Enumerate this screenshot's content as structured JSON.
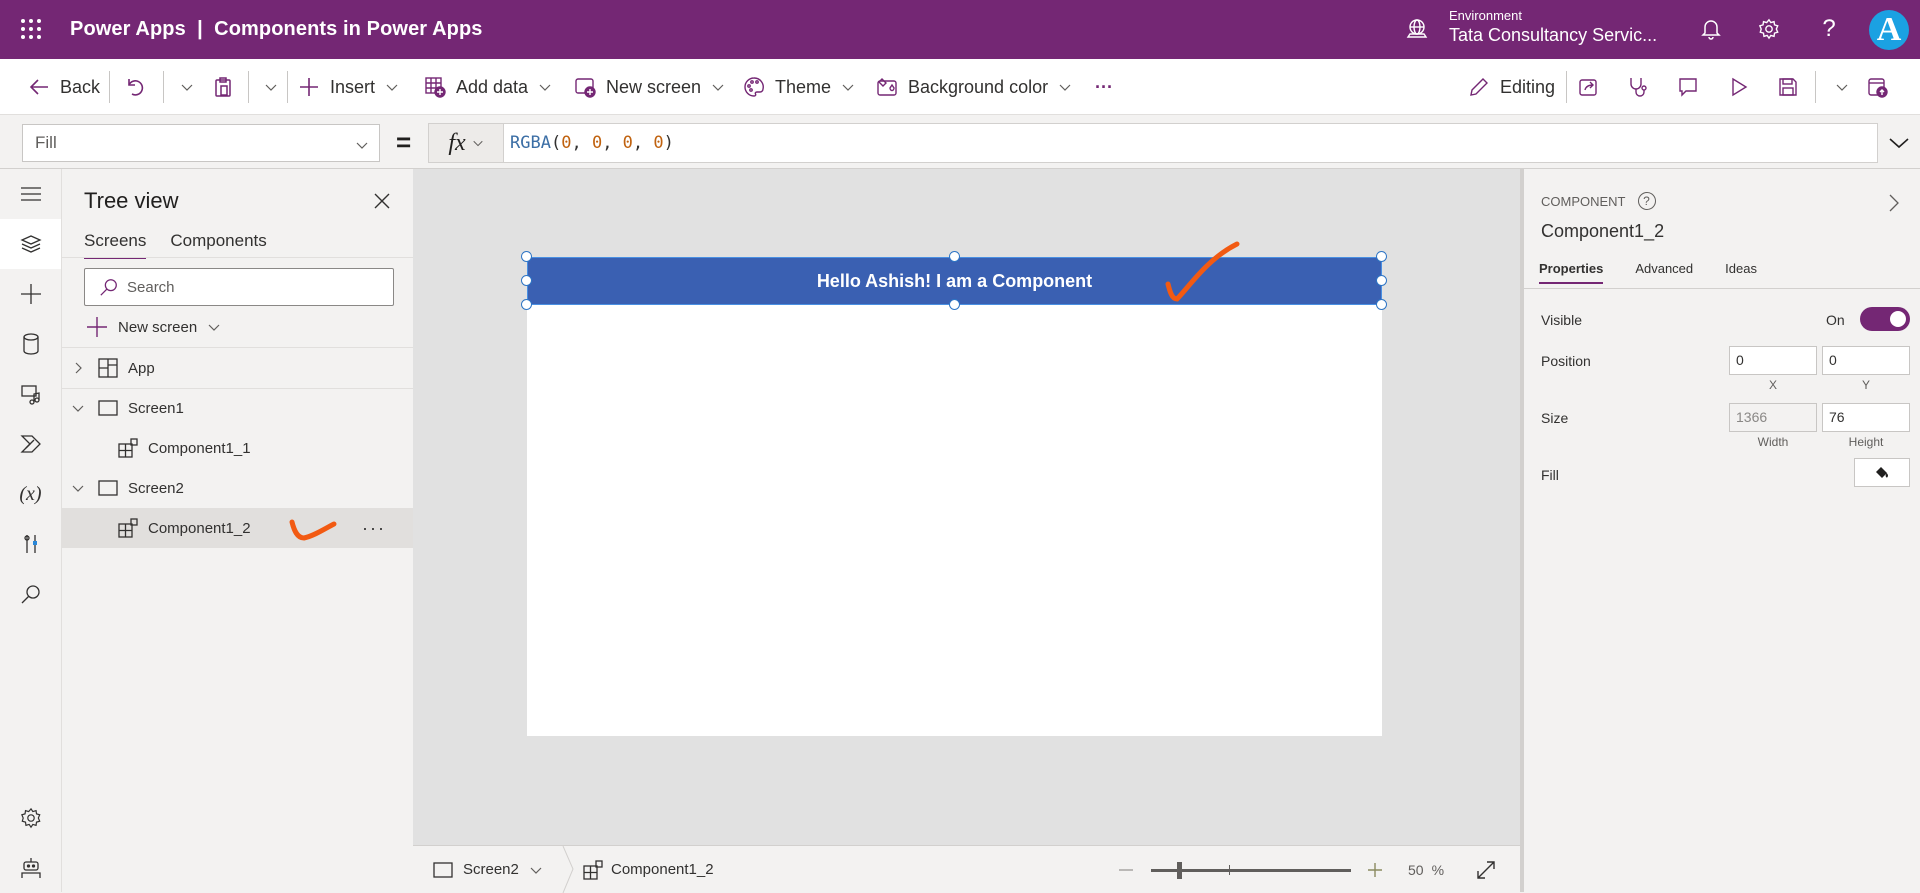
{
  "header": {
    "app_title": "Power Apps  |  Components in Power Apps",
    "environment_label": "Environment",
    "environment_name": "Tata Consultancy Servic...",
    "avatar_initial": "A",
    "brand_color": "#742774"
  },
  "toolbar": {
    "back": "Back",
    "insert": "Insert",
    "add_data": "Add data",
    "new_screen": "New screen",
    "theme": "Theme",
    "background_color": "Background color",
    "more": "···",
    "editing": "Editing"
  },
  "formula_bar": {
    "property": "Fill",
    "equals": "=",
    "fx": "fx",
    "formula_fn": "RGBA",
    "formula_args": [
      "0",
      "0",
      "0",
      "0"
    ]
  },
  "tree_view": {
    "title": "Tree view",
    "tabs": [
      {
        "label": "Screens",
        "active": true
      },
      {
        "label": "Components",
        "active": false
      }
    ],
    "search_placeholder": "Search",
    "new_screen": "New screen",
    "items": [
      {
        "label": "App",
        "level": 0,
        "expanded": false,
        "type": "app"
      },
      {
        "label": "Screen1",
        "level": 0,
        "expanded": true,
        "type": "screen"
      },
      {
        "label": "Component1_1",
        "level": 1,
        "type": "component"
      },
      {
        "label": "Screen2",
        "level": 0,
        "expanded": true,
        "type": "screen"
      },
      {
        "label": "Component1_2",
        "level": 1,
        "type": "component",
        "selected": true
      }
    ],
    "more_label": "···"
  },
  "canvas": {
    "component_text": "Hello Ashish! I am a Component",
    "component_color": "#3a60b2"
  },
  "status_bar": {
    "screen": "Screen2",
    "component": "Component1_2",
    "zoom_value": "50",
    "zoom_unit": "%",
    "zoom_percent": 50
  },
  "properties": {
    "kind": "COMPONENT",
    "name": "Component1_2",
    "tabs": [
      {
        "label": "Properties",
        "active": true
      },
      {
        "label": "Advanced",
        "active": false
      },
      {
        "label": "Ideas",
        "active": false
      }
    ],
    "visible_label": "Visible",
    "visible_state": "On",
    "position_label": "Position",
    "x": "0",
    "y": "0",
    "x_label": "X",
    "y_label": "Y",
    "size_label": "Size",
    "width": "1366",
    "height": "76",
    "width_label": "Width",
    "height_label": "Height",
    "fill_label": "Fill"
  }
}
